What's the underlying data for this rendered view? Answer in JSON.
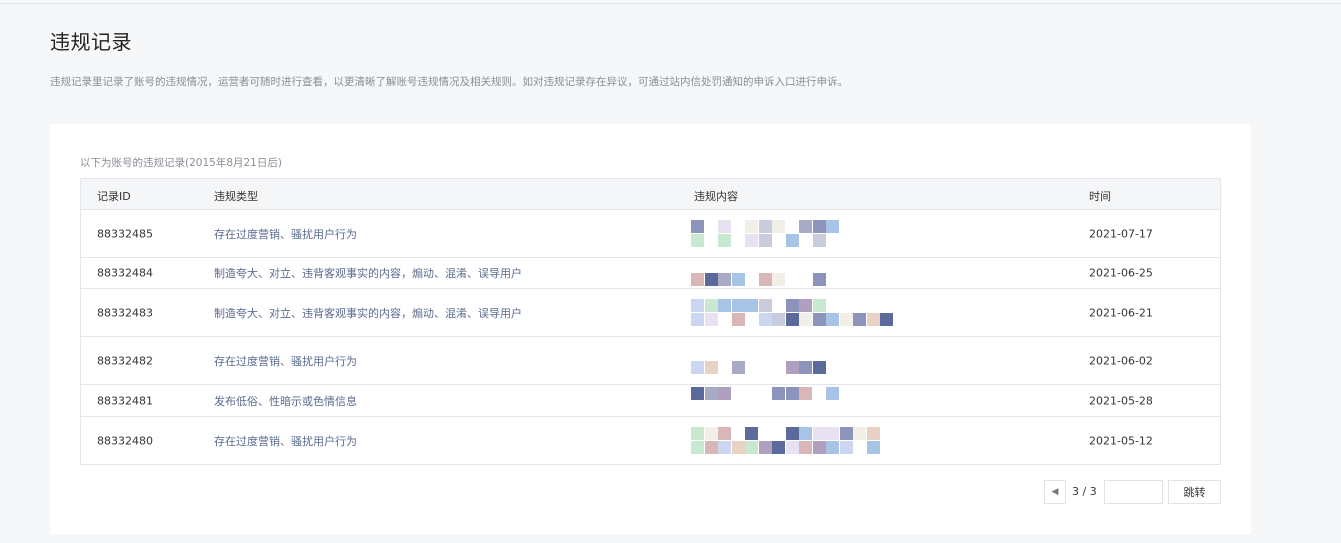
{
  "page": {
    "title": "违规记录",
    "description": "违规记录里记录了账号的违规情况，运营者可随时进行查看，以更清晰了解账号违规情况及相关规则。如对违规记录存在异议，可通过站内信处罚通知的申诉入口进行申诉。"
  },
  "card": {
    "caption": "以下为账号的违规记录(2015年8月21日后)"
  },
  "table": {
    "headers": [
      "记录ID",
      "违规类型",
      "违规内容",
      "时间"
    ],
    "rows": [
      {
        "id": "88332485",
        "type": "存在过度营销、骚扰用户行为",
        "time": "2021-07-17"
      },
      {
        "id": "88332484",
        "type": "制造夸大、对立、违背客观事实的内容，煽动、混淆、误导用户",
        "time": "2021-06-25"
      },
      {
        "id": "88332483",
        "type": "制造夸大、对立、违背客观事实的内容，煽动、混淆、误导用户",
        "time": "2021-06-21"
      },
      {
        "id": "88332482",
        "type": "存在过度营销、骚扰用户行为",
        "time": "2021-06-02"
      },
      {
        "id": "88332481",
        "type": "发布低俗、性暗示或色情信息",
        "time": "2021-05-28"
      },
      {
        "id": "88332480",
        "type": "存在过度营销、骚扰用户行为",
        "time": "2021-05-12"
      }
    ]
  },
  "pagination": {
    "info": "3 / 3",
    "prev_icon": "chevron-left-icon",
    "page_input_value": "",
    "jump_label": "跳转"
  },
  "colors": {
    "link_text": "#5a6a90",
    "muted_text": "#8a8e96",
    "border": "#e4e6eb",
    "header_bg": "#f5f6f8"
  }
}
